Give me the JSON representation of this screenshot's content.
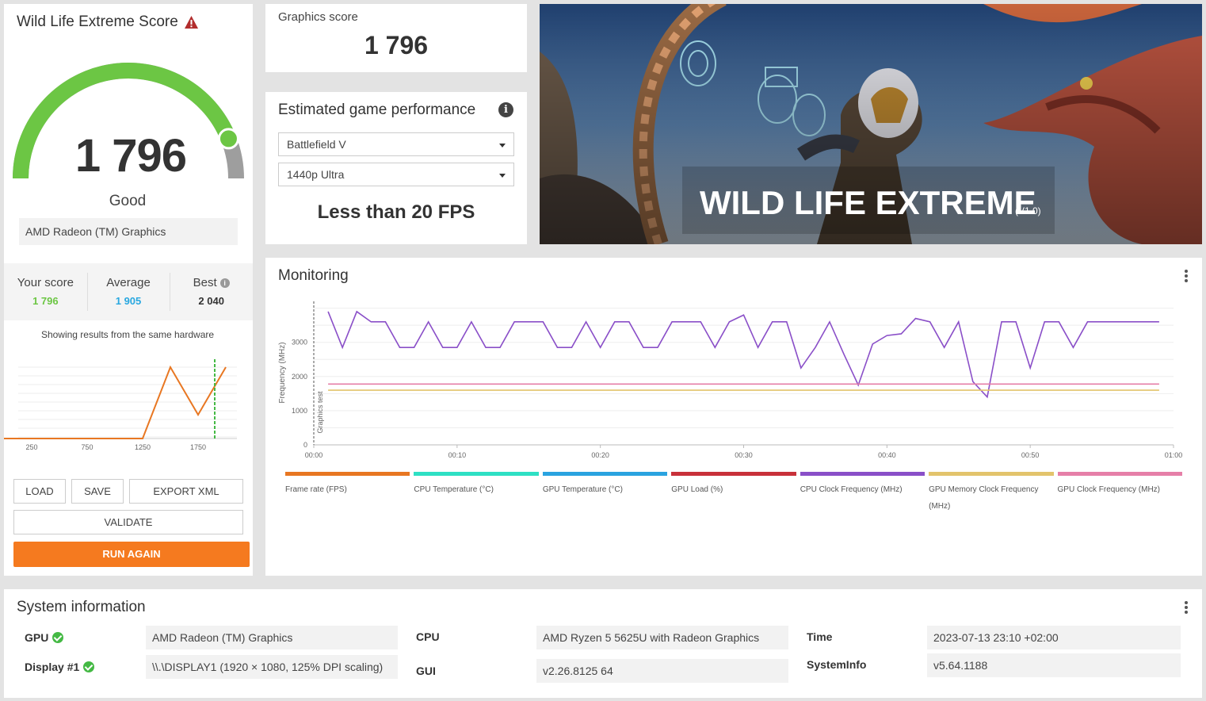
{
  "score_card": {
    "title": "Wild Life Extreme Score",
    "score": "1 796",
    "rating": "Good",
    "gpu": "AMD Radeon (TM) Graphics",
    "gauge_fraction": 0.88,
    "colors": {
      "accent": "#6cc644",
      "run": "#f57a1f",
      "average": "#29a8e0"
    }
  },
  "comparison": {
    "your_label": "Your score",
    "your_value": "1 796",
    "avg_label": "Average",
    "avg_value": "1 905",
    "best_label": "Best",
    "best_value": "2 040",
    "showing": "Showing results from the same hardware"
  },
  "distribution": {
    "x_ticks": [
      "250",
      "750",
      "1250",
      "1750"
    ],
    "x_values": [
      250,
      750,
      1250,
      1750
    ],
    "x_range": [
      0,
      2100
    ],
    "curve": [
      [
        0,
        0
      ],
      [
        1250,
        0
      ],
      [
        1500,
        90
      ],
      [
        1750,
        30
      ],
      [
        2000,
        90
      ]
    ],
    "marker": 1900
  },
  "buttons": {
    "load": "LOAD",
    "save": "SAVE",
    "export": "EXPORT XML",
    "validate": "VALIDATE",
    "run_again": "RUN AGAIN"
  },
  "graphics": {
    "label": "Graphics score",
    "value": "1 796"
  },
  "performance": {
    "title": "Estimated game performance",
    "info_glyph": "i",
    "game": "Battlefield V",
    "preset": "1440p Ultra",
    "result": "Less than 20 FPS"
  },
  "banner": {
    "title": "WILD LIFE EXTREME",
    "version": "(V1.0)"
  },
  "monitoring": {
    "title": "Monitoring",
    "chart_data": {
      "type": "line",
      "ylabel": "Frequency (MHz)",
      "marker_label": "Graphics test",
      "y_ticks": [
        0,
        1000,
        2000,
        3000
      ],
      "ylim": [
        0,
        4200
      ],
      "x_ticks": [
        "00:00",
        "00:10",
        "00:20",
        "00:30",
        "00:40",
        "00:50",
        "01:00"
      ],
      "xlim": [
        0,
        60
      ],
      "series": [
        {
          "name": "CPU Clock Frequency (MHz)",
          "color": "#8a4fc8",
          "x": [
            1,
            2,
            3,
            4,
            5,
            6,
            7,
            8,
            9,
            10,
            11,
            12,
            13,
            14,
            15,
            16,
            17,
            18,
            19,
            20,
            21,
            22,
            23,
            24,
            25,
            26,
            27,
            28,
            29,
            30,
            31,
            32,
            33,
            34,
            35,
            36,
            37,
            38,
            39,
            40,
            41,
            42,
            43,
            44,
            45,
            46,
            47,
            48,
            49,
            50,
            51,
            52,
            53,
            54,
            55,
            56,
            57,
            58,
            59
          ],
          "values": [
            3900,
            2850,
            3900,
            3600,
            3600,
            2850,
            2850,
            3600,
            2850,
            2850,
            3600,
            2850,
            2850,
            3600,
            3600,
            3600,
            2850,
            2850,
            3600,
            2850,
            3600,
            3600,
            2850,
            2850,
            3600,
            3600,
            3600,
            2850,
            3600,
            3800,
            2850,
            3600,
            3600,
            2250,
            2850,
            3600,
            2650,
            1750,
            2950,
            3200,
            3250,
            3700,
            3600,
            2850,
            3600,
            1850,
            1400,
            3600,
            3600,
            2250,
            3600,
            3600,
            2850,
            3600,
            3600,
            3600,
            3600,
            3600,
            3600
          ]
        },
        {
          "name": "GPU Clock Frequency (MHz)",
          "color": "#e67fa8",
          "x": [
            1,
            59
          ],
          "values": [
            1780,
            1780
          ]
        },
        {
          "name": "GPU Memory Clock Frequency (MHz)",
          "color": "#e3c46c",
          "x": [
            1,
            59
          ],
          "values": [
            1600,
            1600
          ]
        }
      ]
    },
    "legend": [
      {
        "label": "Frame rate (FPS)",
        "color": "#e87722"
      },
      {
        "label": "CPU Temperature (°C)",
        "color": "#2ee0c4"
      },
      {
        "label": "GPU Temperature (°C)",
        "color": "#2aa3e0"
      },
      {
        "label": "GPU Load (%)",
        "color": "#c8313a"
      },
      {
        "label": "CPU Clock Frequency (MHz)",
        "color": "#8a4fc8"
      },
      {
        "label": "GPU Memory Clock Frequency (MHz)",
        "color": "#e3c46c"
      },
      {
        "label": "GPU Clock Frequency (MHz)",
        "color": "#e67fa8"
      }
    ]
  },
  "system": {
    "title": "System information",
    "gpu_label": "GPU",
    "gpu_value": "AMD Radeon (TM) Graphics",
    "display_label": "Display #1",
    "display_value": "\\\\.\\DISPLAY1 (1920 × 1080, 125% DPI scaling)",
    "cpu_label": "CPU",
    "cpu_value": "AMD Ryzen 5 5625U with Radeon Graphics",
    "gui_label": "GUI",
    "gui_value": "v2.26.8125 64",
    "time_label": "Time",
    "time_value": "2023-07-13 23:10 +02:00",
    "sysinfo_label": "SystemInfo",
    "sysinfo_value": "v5.64.1188"
  }
}
